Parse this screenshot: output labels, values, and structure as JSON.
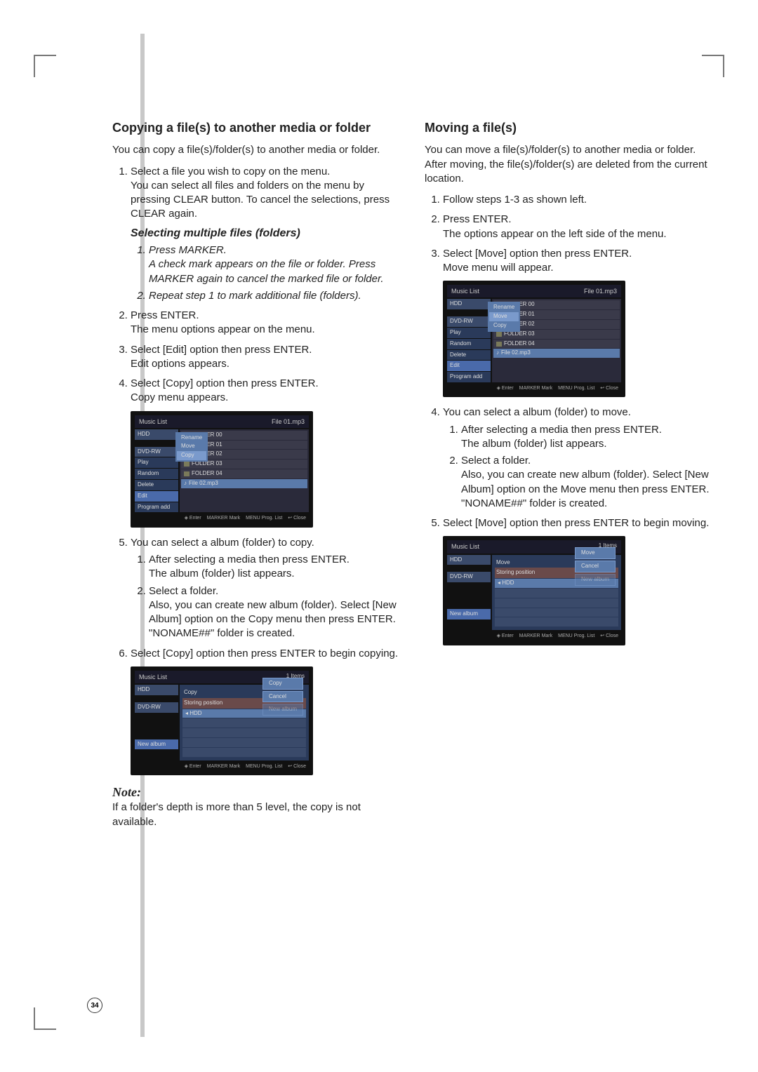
{
  "page_number": "34",
  "left": {
    "heading": "Copying a file(s) to another media or folder",
    "intro": "You can copy a file(s)/folder(s) to another media or folder.",
    "step1_a": "Select a file you wish to copy on the menu.",
    "step1_b": "You can select all files and folders on the menu by pressing CLEAR button. To cancel the selections, press CLEAR again.",
    "multi_heading": "Selecting multiple files (folders)",
    "multi_1a": "Press MARKER.",
    "multi_1b": "A check mark appears on the file or folder. Press MARKER again to cancel the marked file or folder.",
    "multi_2": "Repeat step 1 to mark additional file (folders).",
    "step2_a": "Press ENTER.",
    "step2_b": "The menu options appear on the menu.",
    "step3_a": "Select [Edit] option then press ENTER.",
    "step3_b": "Edit options appears.",
    "step4_a": "Select [Copy] option then press ENTER.",
    "step4_b": "Copy menu appears.",
    "step5": "You can select a album (folder) to copy.",
    "step5_1a": "After selecting a media then press ENTER.",
    "step5_1b": "The album (folder) list appears.",
    "step5_2a": "Select a folder.",
    "step5_2b": "Also, you can create new album (folder). Select [New Album] option on the Copy menu then press ENTER.",
    "step5_2c": "\"NONAME##\" folder is created.",
    "step6": "Select [Copy] option then press ENTER to begin copying.",
    "note_label": "Note:",
    "note_body": "If a folder's depth is more than 5 level, the copy is not available."
  },
  "right": {
    "heading": "Moving a file(s)",
    "intro": "You can move a file(s)/folder(s) to another media or folder. After moving, the file(s)/folder(s) are deleted from the current location.",
    "step1": "Follow steps 1-3 as shown left.",
    "step2_a": "Press ENTER.",
    "step2_b": "The options appear on the left side of the menu.",
    "step3_a": "Select [Move] option then press ENTER.",
    "step3_b": "Move menu will appear.",
    "step4": "You can select a album (folder) to move.",
    "step4_1a": "After selecting a media then press ENTER.",
    "step4_1b": "The album (folder) list appears.",
    "step4_2a": "Select a folder.",
    "step4_2b": "Also, you can create new album (folder). Select [New Album] option on the Move menu then press ENTER.",
    "step4_2c": "\"NONAME##\" folder is created.",
    "step5": "Select [Move] option then press ENTER to begin moving."
  },
  "ss": {
    "title": "Music List",
    "file1": "File 01.mp3",
    "file2": "File 02.mp3",
    "hdd": "HDD",
    "dvdrw": "DVD-RW",
    "play": "Play",
    "random": "Random",
    "delete": "Delete",
    "edit": "Edit",
    "program_add": "Program add",
    "rename": "Rename",
    "move": "Move",
    "copy": "Copy",
    "cancel": "Cancel",
    "new_album": "New album",
    "f00": "FOLDER 00",
    "f01": "FOLDER 01",
    "f02": "FOLDER 02",
    "f03": "FOLDER 03",
    "f04": "FOLDER 04",
    "storing": "Storing position",
    "enter": "Enter",
    "mark": "Mark",
    "prog": "Prog. List",
    "close": "Close",
    "items1": "1 Items",
    "marker": "MARKER",
    "menu": "MENU"
  }
}
